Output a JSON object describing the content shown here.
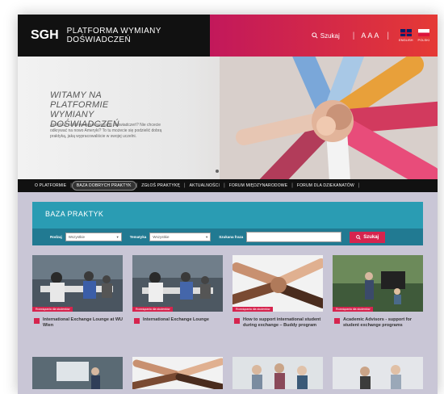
{
  "header": {
    "logo": "SGH",
    "platform_name": "PLATFORMA WYMIANY DOŚWIADCZEŃ",
    "search_label": "Szukaj",
    "font_sizes": "AAA",
    "languages": [
      "ENGLISH",
      "POLSKI"
    ]
  },
  "hero": {
    "title": "WITAMY NA PLATFORMIE WYMIANY DOŚWIADCZEŃ",
    "text": "Jesteście zainteresowani wymianą doświadczeń? Nie chcecie odkrywać na nowo Ameryki? To tu możecie się podzielić dobrą praktyką, jaką wypracowaliście w swojej uczelni."
  },
  "nav": {
    "items": [
      "O PLATFORMIE",
      "BAZA DOBRYCH PRAKTYK",
      "ZGŁOŚ PRAKTYKĘ",
      "AKTUALNOŚCI",
      "FORUM MIĘDZYNARODOWE",
      "FORUM DLA DZIEKANATÓW"
    ]
  },
  "baza": {
    "title": "BAZA PRAKTYK",
    "filters": {
      "label1": "Rodzaj",
      "select1": "Wszystkie",
      "label2": "Tematyka",
      "select2": "Wszystkie",
      "label3": "Szukana fraza",
      "search_value": "",
      "search_button": "Szukaj"
    }
  },
  "cards": [
    {
      "badge": "Rozwiązania dla studentów",
      "title": "International Exchange Lounge at WU Wien"
    },
    {
      "badge": "Rozwiązania dla studentów",
      "title": "International Exchange Lounge"
    },
    {
      "badge": "Rozwiązania dla studentów",
      "title": "How to support international student during exchange – Buddy program"
    },
    {
      "badge": "Rozwiązania dla studentów",
      "title": "Academic Advisors - support for student exchange programs"
    }
  ],
  "colors": {
    "accent": "#d6244e",
    "teal": "#2a9cb3",
    "dark": "#111111"
  }
}
